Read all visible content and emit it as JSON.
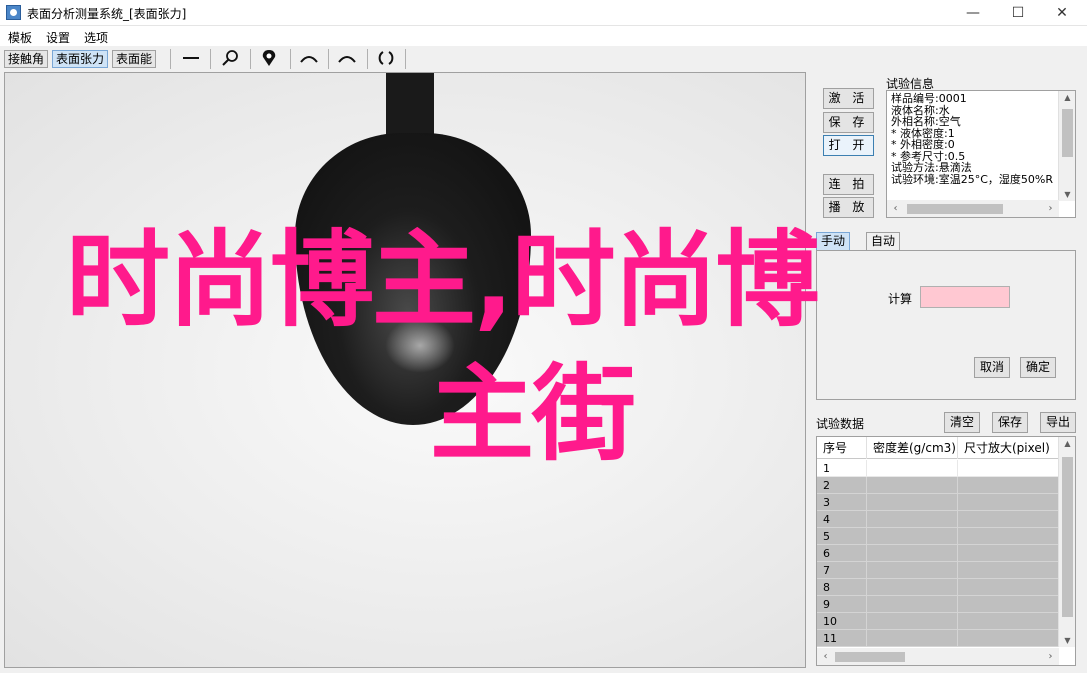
{
  "window": {
    "title": "表面分析测量系统_[表面张力]",
    "minimize": "—",
    "maximize": "☐",
    "close": "✕"
  },
  "menu": [
    "模板",
    "设置",
    "选项"
  ],
  "toolbar": {
    "tabs": [
      "接触角",
      "表面张力",
      "表面能"
    ],
    "active_tab": "表面张力",
    "icons": [
      "line-tool-icon",
      "zoom-icon",
      "locate-pin-icon",
      "arc-left-icon",
      "arc-right-icon",
      "rotate-icon"
    ]
  },
  "overlay_text": {
    "line1": "时尚博主,时尚博",
    "line2": "主街",
    "color": "#ff1a8c"
  },
  "buttons": {
    "detect": "激 活",
    "save": "保 存",
    "open": "打 开",
    "continuous": "连 拍",
    "play": "播 放",
    "cancel": "取消",
    "confirm": "确定",
    "clear": "清空",
    "save_data": "保存",
    "export": "导出"
  },
  "experiment_info": {
    "label": "试验信息",
    "lines": [
      "样品编号:0001",
      "液体名称:水",
      "外相名称:空气",
      "* 液体密度:1",
      "* 外相密度:0",
      "* 参考尺寸:0.5",
      "试验方法:悬滴法",
      "试验环境:室温25°C，湿度50%R"
    ]
  },
  "param_tabs": [
    "手动",
    "自动"
  ],
  "param_field_label": "计算",
  "data_table": {
    "label": "试验数据",
    "columns": [
      "序号",
      "密度差(g/cm3)",
      "尺寸放大(pixel)"
    ],
    "rows": [
      "1",
      "2",
      "3",
      "4",
      "5",
      "6",
      "7",
      "8",
      "9",
      "10",
      "11"
    ]
  }
}
